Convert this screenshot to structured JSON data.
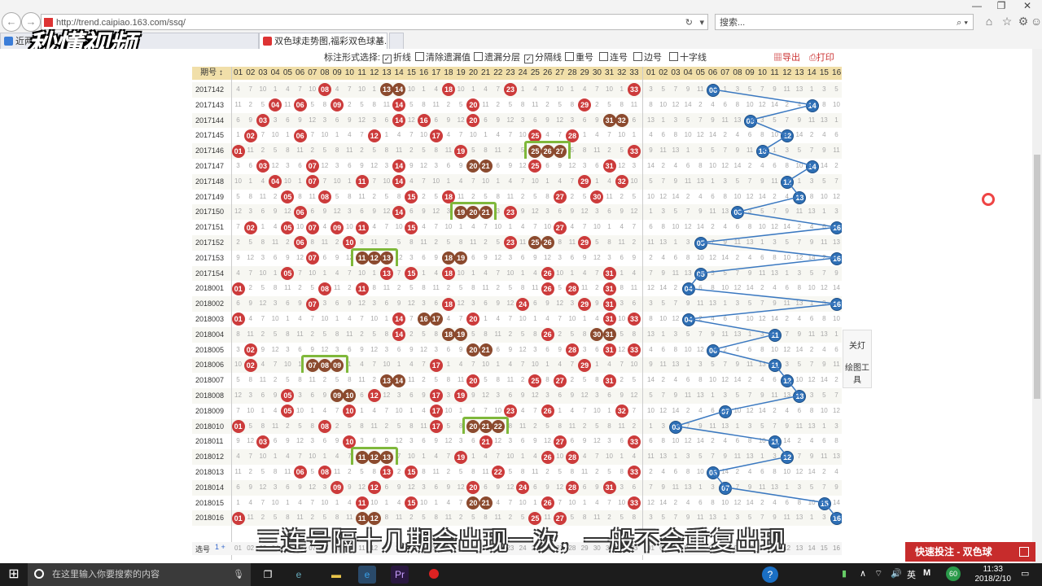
{
  "browser": {
    "url": "http://trend.caipiao.163.com/ssq/",
    "search_placeholder": "搜索...",
    "tabs": [
      {
        "label": "近两百...势（最近200期） - ..."
      },
      {
        "label": "双色球走势图,福彩双色球基..."
      }
    ]
  },
  "overlay": {
    "watermark": "秒懂视频",
    "caption": "三连号隔十几期会出现一次，一般不会重复出现"
  },
  "toolbar": {
    "label": "标注形式选择:",
    "options": [
      {
        "label": "折线",
        "checked": "✓"
      },
      {
        "label": "清除遗漏值",
        "checked": ""
      },
      {
        "label": "遗漏分层",
        "checked": ""
      },
      {
        "label": "分隔线",
        "checked": "✓"
      },
      {
        "label": "重号",
        "checked": ""
      },
      {
        "label": "连号",
        "checked": ""
      },
      {
        "label": "边号",
        "checked": ""
      },
      {
        "label": "十字线",
        "checked": ""
      }
    ],
    "export_label": "导出",
    "print_label": "打印"
  },
  "table": {
    "period_header": "期号 ↕",
    "red_headers": [
      "01",
      "02",
      "03",
      "04",
      "05",
      "06",
      "07",
      "08",
      "09",
      "10",
      "11",
      "12",
      "13",
      "14",
      "15",
      "16",
      "17",
      "18",
      "19",
      "20",
      "21",
      "22",
      "23",
      "24",
      "25",
      "26",
      "27",
      "28",
      "29",
      "30",
      "31",
      "32",
      "33"
    ],
    "blue_headers": [
      "01",
      "02",
      "03",
      "04",
      "05",
      "06",
      "07",
      "08",
      "09",
      "10",
      "11",
      "12",
      "13",
      "14",
      "15",
      "16"
    ],
    "footer_label": "选号",
    "rows": [
      {
        "period": "2017142",
        "red": [
          8,
          13,
          14,
          18,
          23,
          33
        ],
        "blue": 6
      },
      {
        "period": "2017143",
        "red": [
          4,
          6,
          9,
          14,
          20,
          29
        ],
        "blue": 14
      },
      {
        "period": "2017144",
        "red": [
          3,
          14,
          16,
          20,
          31,
          32
        ],
        "blue": 9
      },
      {
        "period": "2017145",
        "red": [
          2,
          6,
          12,
          17,
          25,
          28
        ],
        "blue": 12
      },
      {
        "period": "2017146",
        "red": [
          1,
          19,
          25,
          26,
          27,
          33
        ],
        "blue": 10
      },
      {
        "period": "2017147",
        "red": [
          3,
          7,
          14,
          20,
          21,
          25,
          31
        ],
        "blue": 14
      },
      {
        "period": "2017148",
        "red": [
          4,
          7,
          11,
          14,
          29,
          32
        ],
        "blue": 12
      },
      {
        "period": "2017149",
        "red": [
          5,
          8,
          15,
          18,
          27,
          30
        ],
        "blue": 13
      },
      {
        "period": "2017150",
        "red": [
          6,
          14,
          19,
          20,
          21,
          23
        ],
        "blue": 8
      },
      {
        "period": "2017151",
        "red": [
          2,
          5,
          7,
          9,
          11,
          15,
          27
        ],
        "blue": 16
      },
      {
        "period": "2017152",
        "red": [
          6,
          10,
          23,
          25,
          26,
          29
        ],
        "blue": 5
      },
      {
        "period": "2017153",
        "red": [
          7,
          11,
          12,
          13,
          18,
          19
        ],
        "blue": 16
      },
      {
        "period": "2017154",
        "red": [
          5,
          13,
          15,
          18,
          26,
          31
        ],
        "blue": 5
      },
      {
        "period": "2018001",
        "red": [
          1,
          8,
          11,
          26,
          28,
          31
        ],
        "blue": 4
      },
      {
        "period": "2018002",
        "red": [
          7,
          18,
          24,
          29,
          31
        ],
        "blue": 16
      },
      {
        "period": "2018003",
        "red": [
          1,
          14,
          16,
          17,
          20,
          31,
          33
        ],
        "blue": 4
      },
      {
        "period": "2018004",
        "red": [
          14,
          18,
          19,
          26,
          30,
          31
        ],
        "blue": 11
      },
      {
        "period": "2018005",
        "red": [
          2,
          20,
          21,
          28,
          31,
          33
        ],
        "blue": 6
      },
      {
        "period": "2018006",
        "red": [
          2,
          7,
          8,
          9,
          17,
          29
        ],
        "blue": 11
      },
      {
        "period": "2018007",
        "red": [
          13,
          14,
          20,
          25,
          27,
          31
        ],
        "blue": 12
      },
      {
        "period": "2018008",
        "red": [
          5,
          9,
          10,
          12,
          17,
          19
        ],
        "blue": 13
      },
      {
        "period": "2018009",
        "red": [
          5,
          10,
          17,
          23,
          26,
          32
        ],
        "blue": 7
      },
      {
        "period": "2018010",
        "red": [
          1,
          8,
          17,
          20,
          21,
          22
        ],
        "blue": 3
      },
      {
        "period": "2018011",
        "red": [
          3,
          10,
          21,
          27,
          33
        ],
        "blue": 11
      },
      {
        "period": "2018012",
        "red": [
          11,
          12,
          13,
          19,
          26,
          28
        ],
        "blue": 12
      },
      {
        "period": "2018013",
        "red": [
          6,
          8,
          13,
          15,
          22,
          33
        ],
        "blue": 6
      },
      {
        "period": "2018014",
        "red": [
          9,
          12,
          20,
          24,
          28,
          31
        ],
        "blue": 7
      },
      {
        "period": "2018015",
        "red": [
          11,
          15,
          20,
          21,
          26,
          33
        ],
        "blue": 15
      },
      {
        "period": "2018016",
        "red": [
          1,
          11,
          12,
          25,
          27
        ],
        "blue": 16
      }
    ]
  },
  "sidetool": {
    "lights": "关灯",
    "draw": "绘图工具"
  },
  "quick_bet": "快速投注 - 双色球",
  "taskbar": {
    "search_placeholder": "在这里输入你要搜索的内容",
    "ime": "英",
    "badge": "60",
    "time": "11:33",
    "date": "2018/2/10"
  }
}
